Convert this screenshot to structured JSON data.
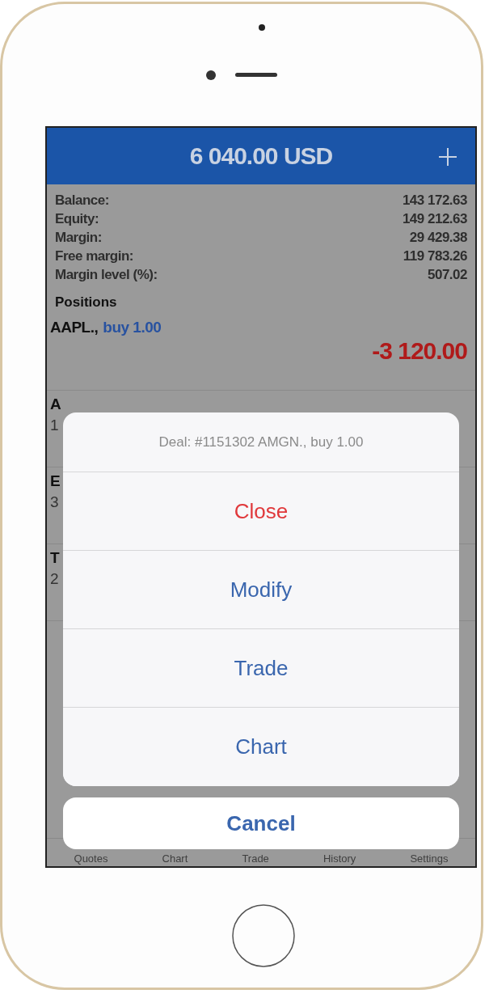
{
  "header": {
    "title": "6 040.00 USD"
  },
  "summary": [
    {
      "label": "Balance:",
      "value": "143 172.63"
    },
    {
      "label": "Equity:",
      "value": "149 212.63"
    },
    {
      "label": "Margin:",
      "value": "29 429.38"
    },
    {
      "label": "Free margin:",
      "value": "119 783.26"
    },
    {
      "label": "Margin level (%):",
      "value": "507.02"
    }
  ],
  "positions_title": "Positions",
  "positions": [
    {
      "symbol": "AAPL.,",
      "side": "buy 1.00",
      "profit": "-3 120.00"
    },
    {
      "symbol": "A",
      "price": "1"
    },
    {
      "symbol": "E",
      "price": "3"
    },
    {
      "symbol": "T",
      "price": "2"
    }
  ],
  "action_sheet": {
    "title": "Deal: #1151302 AMGN., buy 1.00",
    "actions": [
      {
        "label": "Close",
        "kind": "destructive"
      },
      {
        "label": "Modify",
        "kind": "default"
      },
      {
        "label": "Trade",
        "kind": "default"
      },
      {
        "label": "Chart",
        "kind": "default"
      }
    ],
    "cancel": "Cancel"
  },
  "tab_bar": [
    "Quotes",
    "Chart",
    "Trade",
    "History",
    "Settings"
  ]
}
